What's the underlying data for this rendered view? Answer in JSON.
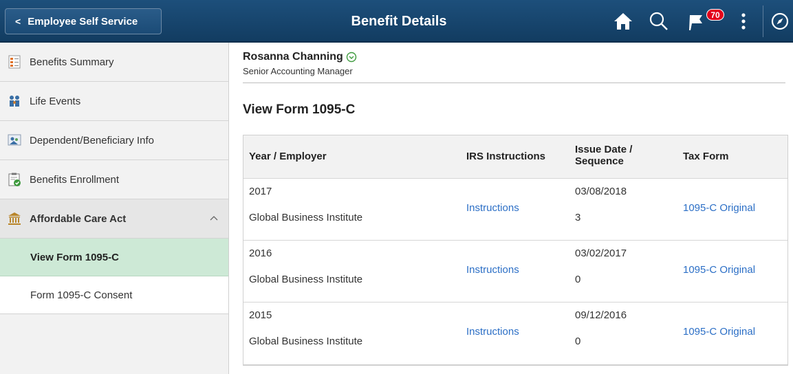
{
  "header": {
    "back_label": "Employee Self Service",
    "title": "Benefit Details",
    "notification_count": "70",
    "icons": [
      "chevron-left-icon",
      "home-icon",
      "search-icon",
      "flag-icon",
      "more-vertical-icon",
      "compass-icon"
    ],
    "colors": {
      "bar": "#1d4f7b",
      "badge": "#e3001b"
    }
  },
  "sidebar": {
    "items": [
      {
        "label": "Benefits Summary",
        "icon": "benefits-summary-icon"
      },
      {
        "label": "Life Events",
        "icon": "life-events-icon"
      },
      {
        "label": "Dependent/Beneficiary Info",
        "icon": "dependent-info-icon"
      },
      {
        "label": "Benefits Enrollment",
        "icon": "clipboard-check-icon"
      }
    ],
    "group": {
      "label": "Affordable Care Act",
      "icon": "courthouse-icon",
      "expanded": true,
      "children": [
        {
          "label": "View Form 1095-C",
          "active": true
        },
        {
          "label": "Form 1095-C Consent",
          "active": false
        }
      ]
    },
    "active_color": "#cde9d6"
  },
  "employee": {
    "name": "Rosanna Channing",
    "job_title": "Senior Accounting Manager"
  },
  "main": {
    "section_title": "View Form 1095-C",
    "columns": {
      "year_employer": "Year / Employer",
      "irs": "IRS Instructions",
      "issue_line1": "Issue Date /",
      "issue_line2": "Sequence",
      "tax_form": "Tax Form"
    },
    "rows": [
      {
        "year": "2017",
        "employer": "Global Business Institute",
        "instructions": "Instructions",
        "issue_date": "03/08/2018",
        "sequence": "3",
        "tax_form": "1095-C Original"
      },
      {
        "year": "2016",
        "employer": "Global Business Institute",
        "instructions": "Instructions",
        "issue_date": "03/02/2017",
        "sequence": "0",
        "tax_form": "1095-C Original"
      },
      {
        "year": "2015",
        "employer": "Global Business Institute",
        "instructions": "Instructions",
        "issue_date": "09/12/2016",
        "sequence": "0",
        "tax_form": "1095-C Original"
      }
    ],
    "link_color": "#2c6fc6"
  }
}
